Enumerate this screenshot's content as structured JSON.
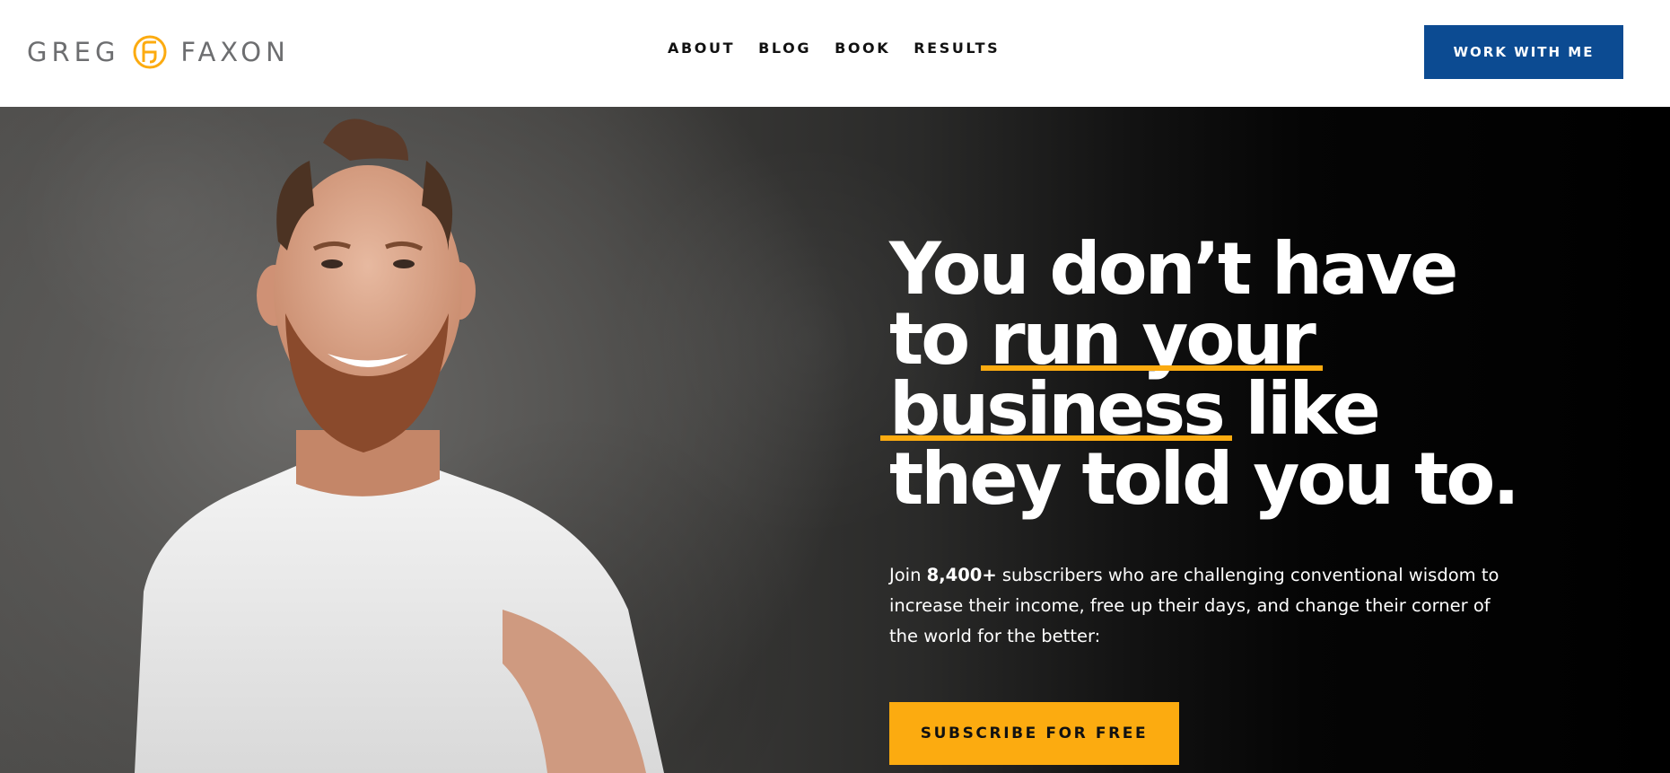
{
  "header": {
    "logo": {
      "first_name": "GREG",
      "last_name": "FAXON",
      "mark_color": "#fcab10",
      "text_color": "#6d6e70"
    },
    "nav": [
      {
        "label": "ABOUT"
      },
      {
        "label": "BLOG"
      },
      {
        "label": "BOOK"
      },
      {
        "label": "RESULTS"
      }
    ],
    "cta": {
      "label": "WORK WITH ME",
      "color": "#0c4b92"
    }
  },
  "hero": {
    "headline": {
      "line1": "You don’t have",
      "line2_lead": "to ",
      "line2_emph": "run your",
      "line3_emph": "business",
      "line3_tail": " like",
      "line4": "they told you to."
    },
    "underline_color": "#fcab10",
    "subcopy": {
      "lead": "Join ",
      "count": "8,400+",
      "rest": " subscribers who are challenging conventional wisdom to increase their income, free up their days, and change their corner of the world for the better:"
    },
    "subscribe": {
      "label": "SUBSCRIBE FOR FREE",
      "color": "#fcab10"
    }
  }
}
